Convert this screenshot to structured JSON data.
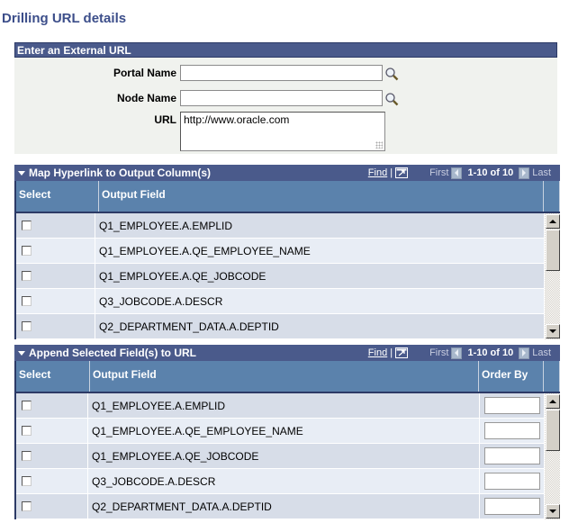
{
  "page": {
    "title": "Drilling URL details"
  },
  "external_url": {
    "header": "Enter an External URL",
    "fields": {
      "portal_name": {
        "label": "Portal Name",
        "value": ""
      },
      "node_name": {
        "label": "Node Name",
        "value": ""
      },
      "url": {
        "label": "URL",
        "value": "http://www.oracle.com"
      }
    }
  },
  "map_hyperlink_grid": {
    "title": "Map Hyperlink to Output Column(s)",
    "find_label": "Find",
    "separator": "|",
    "first_label": "First",
    "count_label": "1-10 of 10",
    "last_label": "Last",
    "columns": [
      "Select",
      "Output Field"
    ],
    "rows": [
      {
        "selected": false,
        "output_field": "Q1_EMPLOYEE.A.EMPLID"
      },
      {
        "selected": false,
        "output_field": "Q1_EMPLOYEE.A.QE_EMPLOYEE_NAME"
      },
      {
        "selected": false,
        "output_field": "Q1_EMPLOYEE.A.QE_JOBCODE"
      },
      {
        "selected": false,
        "output_field": "Q3_JOBCODE.A.DESCR"
      },
      {
        "selected": false,
        "output_field": "Q2_DEPARTMENT_DATA.A.DEPTID"
      }
    ]
  },
  "append_fields_grid": {
    "title": "Append Selected Field(s) to URL",
    "find_label": "Find",
    "separator": "|",
    "first_label": "First",
    "count_label": "1-10 of 10",
    "last_label": "Last",
    "columns": [
      "Select",
      "Output Field",
      "Order By"
    ],
    "rows": [
      {
        "selected": false,
        "output_field": "Q1_EMPLOYEE.A.EMPLID",
        "order_by": ""
      },
      {
        "selected": false,
        "output_field": "Q1_EMPLOYEE.A.QE_EMPLOYEE_NAME",
        "order_by": ""
      },
      {
        "selected": false,
        "output_field": "Q1_EMPLOYEE.A.QE_JOBCODE",
        "order_by": ""
      },
      {
        "selected": false,
        "output_field": "Q3_JOBCODE.A.DESCR",
        "order_by": ""
      },
      {
        "selected": false,
        "output_field": "Q2_DEPARTMENT_DATA.A.DEPTID",
        "order_by": ""
      }
    ]
  },
  "colors": {
    "title": "#3c4e8a",
    "header_bar": "#4a5a8b",
    "column_header": "#5b82ac",
    "row_odd": "#d7dde8",
    "row_even": "#e8edf5",
    "groupbox_bg": "#f0f2ee"
  }
}
